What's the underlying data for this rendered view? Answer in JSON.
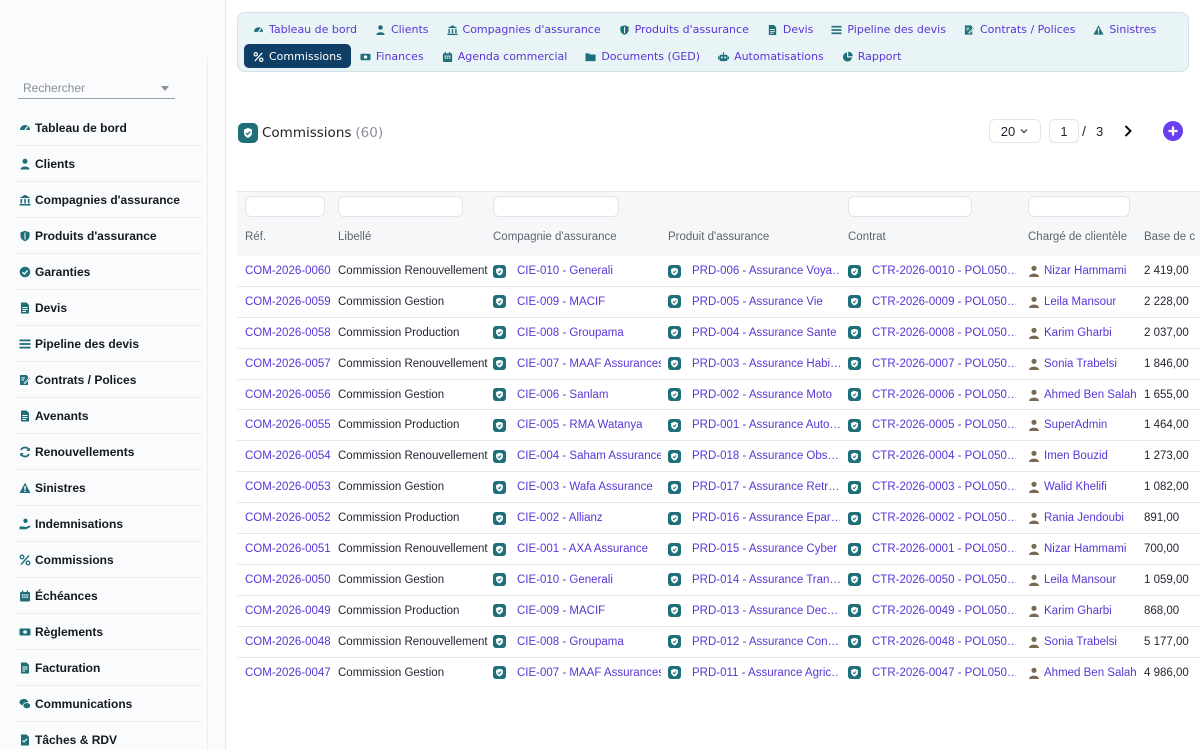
{
  "search": {
    "placeholder": "Rechercher"
  },
  "sidebar": {
    "items": [
      {
        "label": "Tableau de bord",
        "icon": "dashboard-icon"
      },
      {
        "label": "Clients",
        "icon": "user-icon"
      },
      {
        "label": "Compagnies d'assurance",
        "icon": "bank-icon"
      },
      {
        "label": "Produits d'assurance",
        "icon": "shield-icon"
      },
      {
        "label": "Garanties",
        "icon": "check-badge-icon"
      },
      {
        "label": "Devis",
        "icon": "document-icon"
      },
      {
        "label": "Pipeline des devis",
        "icon": "list-icon"
      },
      {
        "label": "Contrats / Polices",
        "icon": "contract-icon"
      },
      {
        "label": "Avenants",
        "icon": "document-icon"
      },
      {
        "label": "Renouvellements",
        "icon": "refresh-icon"
      },
      {
        "label": "Sinistres",
        "icon": "warning-icon"
      },
      {
        "label": "Indemnisations",
        "icon": "hand-coin-icon"
      },
      {
        "label": "Commissions",
        "icon": "percent-icon"
      },
      {
        "label": "Échéances",
        "icon": "calendar-icon"
      },
      {
        "label": "Règlements",
        "icon": "money-icon"
      },
      {
        "label": "Facturation",
        "icon": "invoice-icon"
      },
      {
        "label": "Communications",
        "icon": "chat-icon"
      },
      {
        "label": "Tâches & RDV",
        "icon": "tasks-icon"
      }
    ]
  },
  "topmenu": {
    "row1": [
      {
        "label": "Tableau de bord",
        "icon": "dashboard-icon"
      },
      {
        "label": "Clients",
        "icon": "user-icon"
      },
      {
        "label": "Compagnies d'assurance",
        "icon": "bank-icon"
      },
      {
        "label": "Produits d'assurance",
        "icon": "shield-icon"
      },
      {
        "label": "Devis",
        "icon": "document-icon"
      },
      {
        "label": "Pipeline des devis",
        "icon": "list-icon"
      },
      {
        "label": "Contrats / Polices",
        "icon": "contract-icon"
      },
      {
        "label": "Sinistres",
        "icon": "warning-icon"
      }
    ],
    "row2": [
      {
        "label": "Commissions",
        "icon": "percent-icon",
        "active": true
      },
      {
        "label": "Finances",
        "icon": "money-icon"
      },
      {
        "label": "Agenda commercial",
        "icon": "calendar-icon"
      },
      {
        "label": "Documents (GED)",
        "icon": "folder-icon"
      },
      {
        "label": "Automatisations",
        "icon": "robot-icon"
      },
      {
        "label": "Rapport",
        "icon": "pie-chart-icon"
      }
    ]
  },
  "page": {
    "title": "Commissions",
    "count": "(60)"
  },
  "pager": {
    "per_page": "20",
    "current_page": "1",
    "separator": "/",
    "total_pages": "3"
  },
  "columns": [
    "Réf.",
    "Libellé",
    "Compagnie d'assurance",
    "Produit d'assurance",
    "Contrat",
    "Chargé de clientèle",
    "Base de c"
  ],
  "rows": [
    {
      "ref": "COM-2026-0060",
      "label": "Commission Renouvellement",
      "company": "CIE-010 - Generali",
      "product": "PRD-006 - Assurance Voya…",
      "contract": "CTR-2026-0010 - POL050…",
      "agent": "Nizar Hammami",
      "base": "2 419,00"
    },
    {
      "ref": "COM-2026-0059",
      "label": "Commission Gestion",
      "company": "CIE-009 - MACIF",
      "product": "PRD-005 - Assurance Vie",
      "contract": "CTR-2026-0009 - POL050…",
      "agent": "Leila Mansour",
      "base": "2 228,00"
    },
    {
      "ref": "COM-2026-0058",
      "label": "Commission Production",
      "company": "CIE-008 - Groupama",
      "product": "PRD-004 - Assurance Sante",
      "contract": "CTR-2026-0008 - POL050…",
      "agent": "Karim Gharbi",
      "base": "2 037,00"
    },
    {
      "ref": "COM-2026-0057",
      "label": "Commission Renouvellement",
      "company": "CIE-007 - MAAF Assurances",
      "product": "PRD-003 - Assurance Habi…",
      "contract": "CTR-2026-0007 - POL050…",
      "agent": "Sonia Trabelsi",
      "base": "1 846,00"
    },
    {
      "ref": "COM-2026-0056",
      "label": "Commission Gestion",
      "company": "CIE-006 - Sanlam",
      "product": "PRD-002 - Assurance Moto",
      "contract": "CTR-2026-0006 - POL050…",
      "agent": "Ahmed Ben Salah",
      "base": "1 655,00"
    },
    {
      "ref": "COM-2026-0055",
      "label": "Commission Production",
      "company": "CIE-005 - RMA Watanya",
      "product": "PRD-001 - Assurance Auto…",
      "contract": "CTR-2026-0005 - POL050…",
      "agent": "SuperAdmin",
      "base": "1 464,00"
    },
    {
      "ref": "COM-2026-0054",
      "label": "Commission Renouvellement",
      "company": "CIE-004 - Saham Assurance",
      "product": "PRD-018 - Assurance Obs…",
      "contract": "CTR-2026-0004 - POL050…",
      "agent": "Imen Bouzid",
      "base": "1 273,00"
    },
    {
      "ref": "COM-2026-0053",
      "label": "Commission Gestion",
      "company": "CIE-003 - Wafa Assurance",
      "product": "PRD-017 - Assurance Retr…",
      "contract": "CTR-2026-0003 - POL050…",
      "agent": "Walid Khelifi",
      "base": "1 082,00"
    },
    {
      "ref": "COM-2026-0052",
      "label": "Commission Production",
      "company": "CIE-002 - Allianz",
      "product": "PRD-016 - Assurance Epar…",
      "contract": "CTR-2026-0002 - POL050…",
      "agent": "Rania Jendoubi",
      "base": "891,00"
    },
    {
      "ref": "COM-2026-0051",
      "label": "Commission Renouvellement",
      "company": "CIE-001 - AXA Assurance",
      "product": "PRD-015 - Assurance Cyber",
      "contract": "CTR-2026-0001 - POL050…",
      "agent": "Nizar Hammami",
      "base": "700,00"
    },
    {
      "ref": "COM-2026-0050",
      "label": "Commission Gestion",
      "company": "CIE-010 - Generali",
      "product": "PRD-014 - Assurance Tran…",
      "contract": "CTR-2026-0050 - POL050…",
      "agent": "Leila Mansour",
      "base": "1 059,00"
    },
    {
      "ref": "COM-2026-0049",
      "label": "Commission Production",
      "company": "CIE-009 - MACIF",
      "product": "PRD-013 - Assurance Dec…",
      "contract": "CTR-2026-0049 - POL050…",
      "agent": "Karim Gharbi",
      "base": "868,00"
    },
    {
      "ref": "COM-2026-0048",
      "label": "Commission Renouvellement",
      "company": "CIE-008 - Groupama",
      "product": "PRD-012 - Assurance Con…",
      "contract": "CTR-2026-0048 - POL050…",
      "agent": "Sonia Trabelsi",
      "base": "5 177,00"
    },
    {
      "ref": "COM-2026-0047",
      "label": "Commission Gestion",
      "company": "CIE-007 - MAAF Assurances",
      "product": "PRD-011 - Assurance Agric…",
      "contract": "CTR-2026-0047 - POL050…",
      "agent": "Ahmed Ben Salah",
      "base": "4 986,00"
    }
  ],
  "colors": {
    "accent": "#5a35d6",
    "teal": "#1f6f7a",
    "active_tab": "#0f3f66",
    "add_button": "#6b3ff0"
  }
}
